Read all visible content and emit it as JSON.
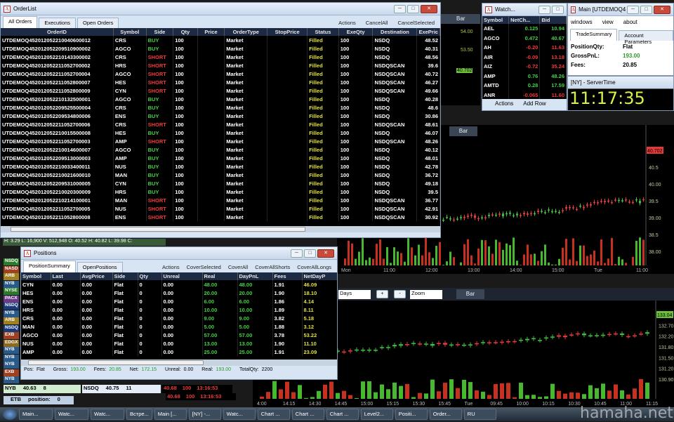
{
  "orderlist": {
    "title": "OrderList",
    "tabs": [
      "All Orders",
      "Executions",
      "Open Orders"
    ],
    "actions": [
      "Actions",
      "CancelAll",
      "CancelSelected"
    ],
    "headers": [
      "OrderID",
      "Symbol",
      "Side",
      "Qty",
      "Price",
      "OrderType",
      "StopPrice",
      "Status",
      "ExeQty",
      "Destination",
      "ExePric"
    ],
    "rows": [
      [
        "UTDEMOQ452012052210040600012",
        "CRS",
        "BUY",
        "100",
        "",
        "Market",
        "",
        "Filled",
        "100",
        "NSDQ",
        "48.52"
      ],
      [
        "UTDEMOQ452012052209510900002",
        "AGCO",
        "BUY",
        "100",
        "",
        "Market",
        "",
        "Filled",
        "100",
        "NSDQ",
        "40.31"
      ],
      [
        "UTDEMOQ452012052210143300002",
        "CRS",
        "SHORT",
        "100",
        "",
        "Market",
        "",
        "Filled",
        "100",
        "NSDQ",
        "48.56"
      ],
      [
        "UTDEMOQ452012052211052700002",
        "HRS",
        "SHORT",
        "100",
        "",
        "Market",
        "",
        "Filled",
        "100",
        "NSDQSCAN",
        "39.6"
      ],
      [
        "UTDEMOQ452012052211052700004",
        "AGCO",
        "SHORT",
        "100",
        "",
        "Market",
        "",
        "Filled",
        "100",
        "NSDQSCAN",
        "40.72"
      ],
      [
        "UTDEMOQ452012052211052800007",
        "HES",
        "SHORT",
        "100",
        "",
        "Market",
        "",
        "Filled",
        "100",
        "NSDQSCAN",
        "46.27"
      ],
      [
        "UTDEMOQ452012052211052800009",
        "CYN",
        "SHORT",
        "100",
        "",
        "Market",
        "",
        "Filled",
        "100",
        "NSDQSCAN",
        "49.66"
      ],
      [
        "UTDEMOQ452012052210132500001",
        "AGCO",
        "BUY",
        "100",
        "",
        "Market",
        "",
        "Filled",
        "100",
        "NSDQ",
        "40.28"
      ],
      [
        "UTDEMOQ452012052209525500004",
        "CRS",
        "BUY",
        "100",
        "",
        "Market",
        "",
        "Filled",
        "100",
        "NSDQ",
        "48.6"
      ],
      [
        "UTDEMOQ452012052209534800006",
        "ENS",
        "BUY",
        "100",
        "",
        "Market",
        "",
        "Filled",
        "100",
        "NSDQ",
        "30.86"
      ],
      [
        "UTDEMOQ452012052211052700006",
        "CRS",
        "SHORT",
        "100",
        "",
        "Market",
        "",
        "Filled",
        "100",
        "NSDQSCAN",
        "48.61"
      ],
      [
        "UTDEMOQ452012052210015500008",
        "HES",
        "BUY",
        "100",
        "",
        "Market",
        "",
        "Filled",
        "100",
        "NSDQ",
        "46.07"
      ],
      [
        "UTDEMOQ452012052211052700003",
        "AMP",
        "SHORT",
        "100",
        "",
        "Market",
        "",
        "Filled",
        "100",
        "NSDQSCAN",
        "48.26"
      ],
      [
        "UTDEMOQ452012052210014600007",
        "AGCO",
        "BUY",
        "100",
        "",
        "Market",
        "",
        "Filled",
        "100",
        "NSDQ",
        "40.12"
      ],
      [
        "UTDEMOQ452012052209513000003",
        "AMP",
        "BUY",
        "100",
        "",
        "Market",
        "",
        "Filled",
        "100",
        "NSDQ",
        "48.01"
      ],
      [
        "UTDEMOQ452012052210033400011",
        "NUS",
        "BUY",
        "100",
        "",
        "Market",
        "",
        "Filled",
        "100",
        "NSDQ",
        "42.78"
      ],
      [
        "UTDEMOQ452012052210021600010",
        "MAN",
        "BUY",
        "100",
        "",
        "Market",
        "",
        "Filled",
        "100",
        "NSDQ",
        "36.72"
      ],
      [
        "UTDEMOQ452012052209531000005",
        "CYN",
        "BUY",
        "100",
        "",
        "Market",
        "",
        "Filled",
        "100",
        "NSDQ",
        "49.18"
      ],
      [
        "UTDEMOQ452012052210020300009",
        "HRS",
        "BUY",
        "100",
        "",
        "Market",
        "",
        "Filled",
        "100",
        "NSDQ",
        "39.5"
      ],
      [
        "UTDEMOQ452012052210214100001",
        "MAN",
        "SHORT",
        "100",
        "",
        "Market",
        "",
        "Filled",
        "100",
        "NSDQSCAN",
        "36.77"
      ],
      [
        "UTDEMOQ452012052211052700005",
        "NUS",
        "SHORT",
        "100",
        "",
        "Market",
        "",
        "Filled",
        "100",
        "NSDQSCAN",
        "42.91"
      ],
      [
        "UTDEMOQ452012052211052800008",
        "ENS",
        "SHORT",
        "100",
        "",
        "Market",
        "",
        "Filled",
        "100",
        "NSDQSCAN",
        "30.92"
      ]
    ]
  },
  "watch": {
    "title": "Watch...",
    "headers": [
      "Symbol",
      "NetCh...",
      "Bid"
    ],
    "rows": [
      [
        "AEL",
        "0.125",
        "10.94"
      ],
      [
        "AGCO",
        "0.472",
        "40.67"
      ],
      [
        "AH",
        "-0.20",
        "11.63"
      ],
      [
        "AIR",
        "-0.09",
        "13.18"
      ],
      [
        "AIZ",
        "-0.72",
        "35.24"
      ],
      [
        "AMP",
        "0.76",
        "48.26"
      ],
      [
        "AMTD",
        "0.28",
        "17.59"
      ],
      [
        "ANR",
        "-0.065",
        "11.60"
      ]
    ],
    "actions": [
      "Actions",
      "Add Row"
    ]
  },
  "mainwin": {
    "title": "Main [UTDEMOQ45]",
    "menu": [
      "windows",
      "view",
      "about"
    ],
    "tabs": [
      "TradeSummary",
      "Account Parameters"
    ],
    "labels": [
      "PositionQty:",
      "GrossPnL:",
      "Fees:"
    ],
    "values": [
      "Flat",
      "193.00",
      "20.85"
    ]
  },
  "servertime": {
    "title": "[NY] - ServerTime",
    "time": "11:17:35"
  },
  "positions": {
    "title": "Positions",
    "tabs": [
      "PositionSummary",
      "OpenPositions"
    ],
    "actions": [
      "Actions",
      "CoverSelected",
      "CoverAll",
      "CoverAllShorts",
      "CoverAllLongs"
    ],
    "headers": [
      "Symbol",
      "Last",
      "AvgPrice",
      "Side",
      "Qty",
      "Unreal",
      "Real",
      "DayPnL",
      "Fees",
      "NetDayP"
    ],
    "rows": [
      [
        "CYN",
        "0.00",
        "0.00",
        "Flat",
        "0",
        "0.00",
        "48.00",
        "48.00",
        "1.91",
        "46.09"
      ],
      [
        "HES",
        "0.00",
        "0.00",
        "Flat",
        "0",
        "0.00",
        "20.00",
        "20.00",
        "1.90",
        "18.10"
      ],
      [
        "ENS",
        "0.00",
        "0.00",
        "Flat",
        "0",
        "0.00",
        "6.00",
        "6.00",
        "1.86",
        "4.14"
      ],
      [
        "HRS",
        "0.00",
        "0.00",
        "Flat",
        "0",
        "0.00",
        "10.00",
        "10.00",
        "1.89",
        "8.11"
      ],
      [
        "CRS",
        "0.00",
        "0.00",
        "Flat",
        "0",
        "0.00",
        "9.00",
        "9.00",
        "3.82",
        "5.18"
      ],
      [
        "MAN",
        "0.00",
        "0.00",
        "Flat",
        "0",
        "0.00",
        "5.00",
        "5.00",
        "1.88",
        "3.12"
      ],
      [
        "AGCO",
        "0.00",
        "0.00",
        "Flat",
        "0",
        "0.00",
        "57.00",
        "57.00",
        "3.78",
        "53.22"
      ],
      [
        "NUS",
        "0.00",
        "0.00",
        "Flat",
        "0",
        "0.00",
        "13.00",
        "13.00",
        "1.90",
        "11.10"
      ],
      [
        "AMP",
        "0.00",
        "0.00",
        "Flat",
        "0",
        "0.00",
        "25.00",
        "25.00",
        "1.91",
        "23.09"
      ]
    ],
    "footer": [
      "Pos:",
      "Flat",
      "Gross:",
      "193.00",
      "Fees:",
      "20.85",
      "Net:",
      "172.15",
      "Unreal:",
      "0.00",
      "Real:",
      "193.00",
      "TotalQty:",
      "2200"
    ]
  },
  "chart1": {
    "bar": "Bar",
    "prices": [
      "41.00",
      "40.5",
      "40.00",
      "39.5",
      "39.00",
      "38.5",
      "38.00"
    ],
    "last": "40.702",
    "times": [
      "Mon",
      "11:00",
      "12:00",
      "13:00",
      "14:00",
      "15:00",
      "Tue",
      "11:00"
    ]
  },
  "chart2": {
    "period": "Days",
    "zoom": "Zoom",
    "plus": "+",
    "minus": "-",
    "bar": "Bar",
    "prices": [
      "133.30",
      "132.70",
      "132.20",
      "131.80",
      "131.50",
      "131.20",
      "130.90"
    ],
    "last": "133.04",
    "times": [
      "4:00",
      "14:15",
      "14:30",
      "14:45",
      "15:00",
      "15:15",
      "15:30",
      "15:45",
      "Tue",
      "09:45",
      "10:00",
      "10:15",
      "10:30",
      "10:45",
      "11:00",
      "11:15"
    ]
  },
  "topchartbar": {
    "prices": [
      "54.00",
      "53.50",
      "52.50",
      "40.702"
    ],
    "bar": "Bar"
  },
  "quoteline": "H: 3.29  L: 16,900  V: 512,948  O: 40.52  H: 40.82  L: 39.98  C:",
  "level2": {
    "rows": [
      [
        "NYB",
        "40.63",
        "8",
        "NSDQ",
        "40.75",
        "11"
      ]
    ],
    "red": [
      [
        "40.68",
        "100",
        "13:16:53"
      ],
      [
        "40.68",
        "100",
        "13:16:53"
      ]
    ],
    "etb": "ETB",
    "position": "position:",
    "posval": "0"
  },
  "sidelabels": [
    "NSDQ",
    "NASD",
    "ARB",
    "NYB",
    "NYSE",
    "PACX",
    "NSDQ",
    "NYB",
    "ARB",
    "NSDQ",
    "EXB",
    "EDGX",
    "NYB",
    "NYB",
    "NYB",
    "EXB",
    "NYB"
  ],
  "taskbar": [
    "Main...",
    "Watc...",
    "Watc...",
    "Встре...",
    "Main [...",
    "[NY] -...",
    "Watc...",
    "Chart ...",
    "Chart ...",
    "Chart ...",
    "Level2...",
    "Positi...",
    "Order...",
    "RU"
  ],
  "watermark": "hamaha.net",
  "colors": {
    "green": "#45d145",
    "red": "#f23a3a",
    "header": "#1d2a44"
  }
}
